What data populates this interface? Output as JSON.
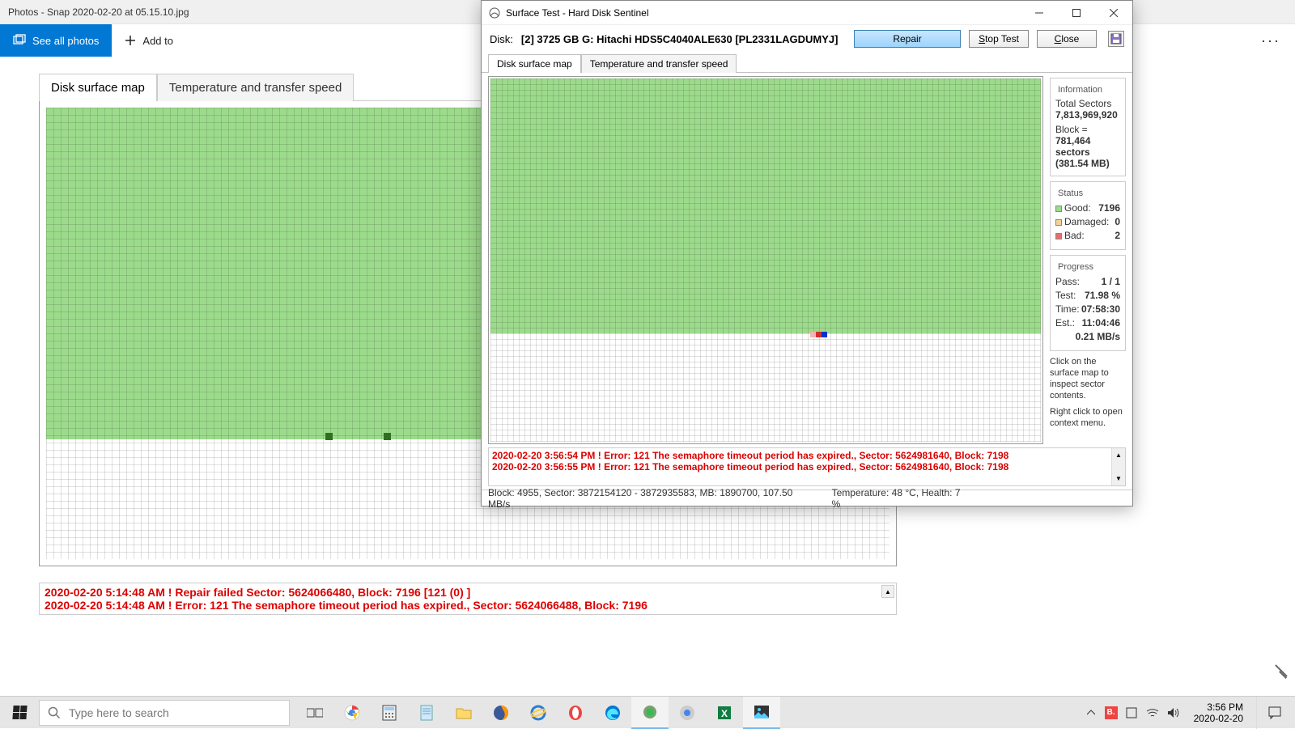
{
  "photos": {
    "title": "Photos - Snap 2020-02-20 at 05.15.10.jpg",
    "see_all": "See all photos",
    "add_to": "Add to",
    "more": "···",
    "tab_map": "Disk surface map",
    "tab_temp": "Temperature and transfer speed",
    "log1": "2020-02-20  5:14:48 AM ! Repair failed  Sector: 5624066480, Block: 7196  [121 (0) ]",
    "log2": "2020-02-20  5:14:48 AM ! Error: 121 The semaphore timeout period has expired., Sector: 5624066488, Block: 7196"
  },
  "dialog": {
    "title": "Surface Test - Hard Disk Sentinel",
    "disk_label": "Disk:",
    "disk_val": "[2] 3725 GB G: Hitachi HDS5C4040ALE630 [PL2331LAGDUMYJ]",
    "repair": "Repair",
    "stop": "top Test",
    "stop_u": "S",
    "close": "lose",
    "close_u": "C",
    "tab_map": "Disk surface map",
    "tab_temp": "Temperature and transfer speed",
    "info_legend": "Information",
    "info_total_k": "Total Sectors",
    "info_total_v": "7,813,969,920",
    "info_block_k": "Block =",
    "info_block_v1": "781,464 sectors",
    "info_block_v2": "(381.54 MB)",
    "status_legend": "Status",
    "good_k": "Good:",
    "good_v": "7196",
    "dam_k": "Damaged:",
    "dam_v": "0",
    "bad_k": "Bad:",
    "bad_v": "2",
    "prog_legend": "Progress",
    "pass_k": "Pass:",
    "pass_v": "1 / 1",
    "test_k": "Test:",
    "test_v": "71.98 %",
    "time_k": "Time:",
    "time_v": "07:58:30",
    "est_k": "Est.:",
    "est_v": "11:04:46",
    "rate": "0.21 MB/s",
    "hint1": "Click on the surface map to inspect sector contents.",
    "hint2": "Right click to open context menu.",
    "log1": "2020-02-20  3:56:54 PM ! Error: 121 The semaphore timeout period has expired., Sector: 5624981640, Block: 7198",
    "log2": "2020-02-20  3:56:55 PM ! Error: 121 The semaphore timeout period has expired., Sector: 5624981640, Block: 7198",
    "status1": "Block: 4955, Sector: 3872154120 - 3872935583, MB: 1890700, 107.50 MB/s",
    "status2": "Temperature: 48  °C,  Health: 7 %"
  },
  "taskbar": {
    "search": "Type here to search",
    "time": "3:56 PM",
    "date": "2020-02-20"
  }
}
